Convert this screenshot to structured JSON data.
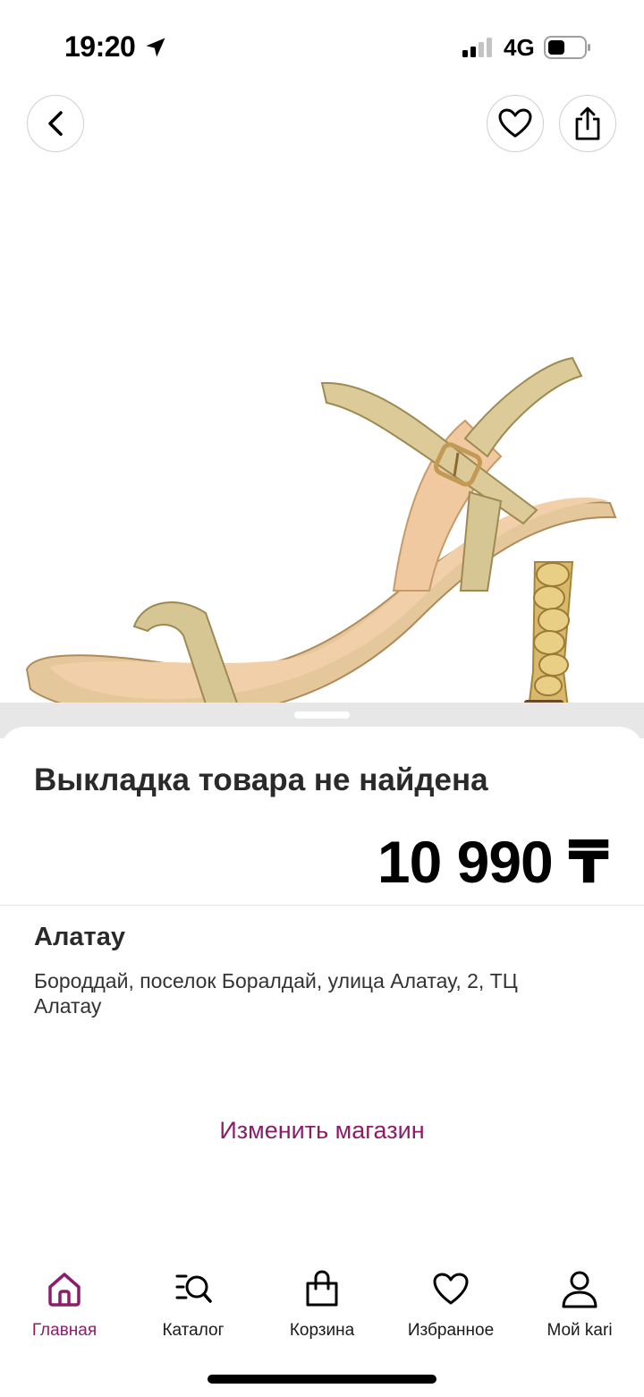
{
  "status_bar": {
    "time": "19:20",
    "network": "4G"
  },
  "product": {
    "title": "Выкладка товара не найдена",
    "price": "10 990 ₸",
    "image_icon": "sandal-image"
  },
  "store": {
    "name": "Алатау",
    "address": "Бороддай, поселок Боралдай, улица Алатау, 2, ТЦ Алатау",
    "change_label": "Изменить магазин"
  },
  "tabs": [
    {
      "label": "Главная",
      "icon": "home-icon",
      "active": true
    },
    {
      "label": "Каталог",
      "icon": "catalog-search-icon",
      "active": false
    },
    {
      "label": "Корзина",
      "icon": "bag-icon",
      "active": false
    },
    {
      "label": "Избранное",
      "icon": "heart-icon",
      "active": false
    },
    {
      "label": "Мой kari",
      "icon": "profile-icon",
      "active": false
    }
  ],
  "colors": {
    "accent": "#8b1d6b",
    "text": "#2a2a2a"
  }
}
